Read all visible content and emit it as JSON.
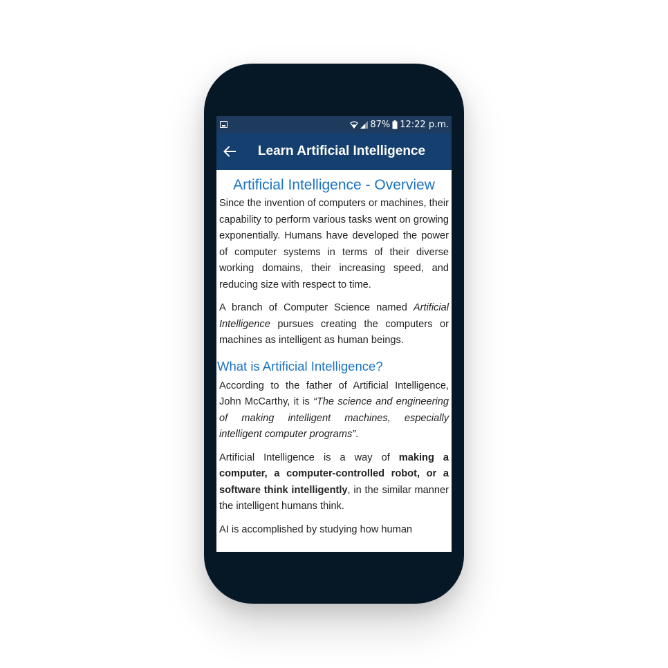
{
  "status_bar": {
    "battery": "87%",
    "time": "12:22 p.m.",
    "icons": [
      "notification-icon",
      "wifi-icon",
      "signal-icon",
      "battery-icon"
    ]
  },
  "app_bar": {
    "title": "Learn Artificial Intelligence",
    "back_icon": "arrow-left-icon"
  },
  "article": {
    "heading": "Artificial Intelligence - Overview",
    "para1": "Since the invention of computers or machines, their capability to perform various tasks went on growing exponentially. Humans have developed the power of computer systems in terms of their diverse working domains, their increasing speed, and reducing size with respect to time.",
    "para2_a": "A branch of Computer Science named ",
    "para2_em": "Artificial Intelligence",
    "para2_b": " pursues creating the computers or machines as intelligent as human beings.",
    "subheading": "What is Artificial Intelligence?",
    "para3_a": "According to the father of Artificial Intelligence, John McCarthy, it is ",
    "para3_em": "“The science and engineering of making intelligent machines, especially intelligent computer programs”",
    "para3_b": ".",
    "para4_a": "Artificial Intelligence is a way of ",
    "para4_strong": "making a computer, a computer-controlled robot, or a software think intelligently",
    "para4_b": ", in the similar manner the intelligent humans think.",
    "para5": "AI is accomplished by studying how human"
  },
  "colors": {
    "status_bar": "#1e3b5e",
    "app_bar": "#143f6e",
    "heading": "#1a73c2",
    "phone_body": "#061726"
  }
}
